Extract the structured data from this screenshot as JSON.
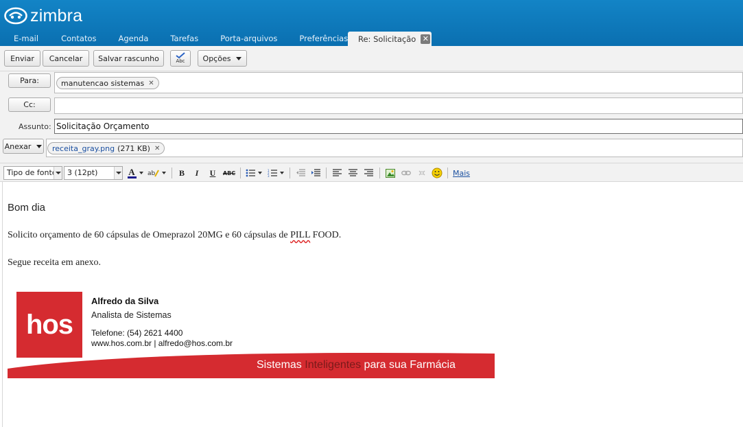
{
  "app": {
    "brand": "zimbra"
  },
  "tabs": [
    "E-mail",
    "Contatos",
    "Agenda",
    "Tarefas",
    "Porta-arquivos",
    "Preferências"
  ],
  "active_tab": {
    "label": "Re: Solicitação"
  },
  "toolbar": {
    "send": "Enviar",
    "cancel": "Cancelar",
    "save_draft": "Salvar rascunho",
    "spell": "Abc",
    "options": "Opções"
  },
  "compose": {
    "to_label": "Para:",
    "to_recipient": "manutencao sistemas",
    "cc_label": "Cc:",
    "cc_value": "",
    "subject_label": "Assunto:",
    "subject_value": "Solicitação Orçamento",
    "attach_label": "Anexar",
    "attachment_name": "receita_gray.png",
    "attachment_size": "(271 KB)"
  },
  "editor_toolbar": {
    "font_family": "Tipo de fonte",
    "font_size": "3 (12pt)",
    "more": "Mais"
  },
  "message": {
    "greeting": "Bom dia",
    "line1_before": "Solicito orçamento de 60 cápsulas de Omeprazol 20MG e 60 cápsulas de ",
    "line1_flagged": "PILL",
    "line1_after": " FOOD.",
    "line2": "Segue receita em anexo."
  },
  "signature": {
    "logo_text": "hos",
    "name": "Alfredo da Silva",
    "role": "Analista de Sistemas",
    "phone": "Telefone: (54) 2621 4400",
    "web": "www.hos.com.br | alfredo@hos.com.br",
    "slogan_part1": "Sistemas ",
    "slogan_highlight": "Inteligentes",
    "slogan_part2": " para sua Farmácia"
  },
  "colors": {
    "header": "#0a6fb0",
    "brand_red": "#d52b30",
    "link": "#1a4fa0"
  }
}
